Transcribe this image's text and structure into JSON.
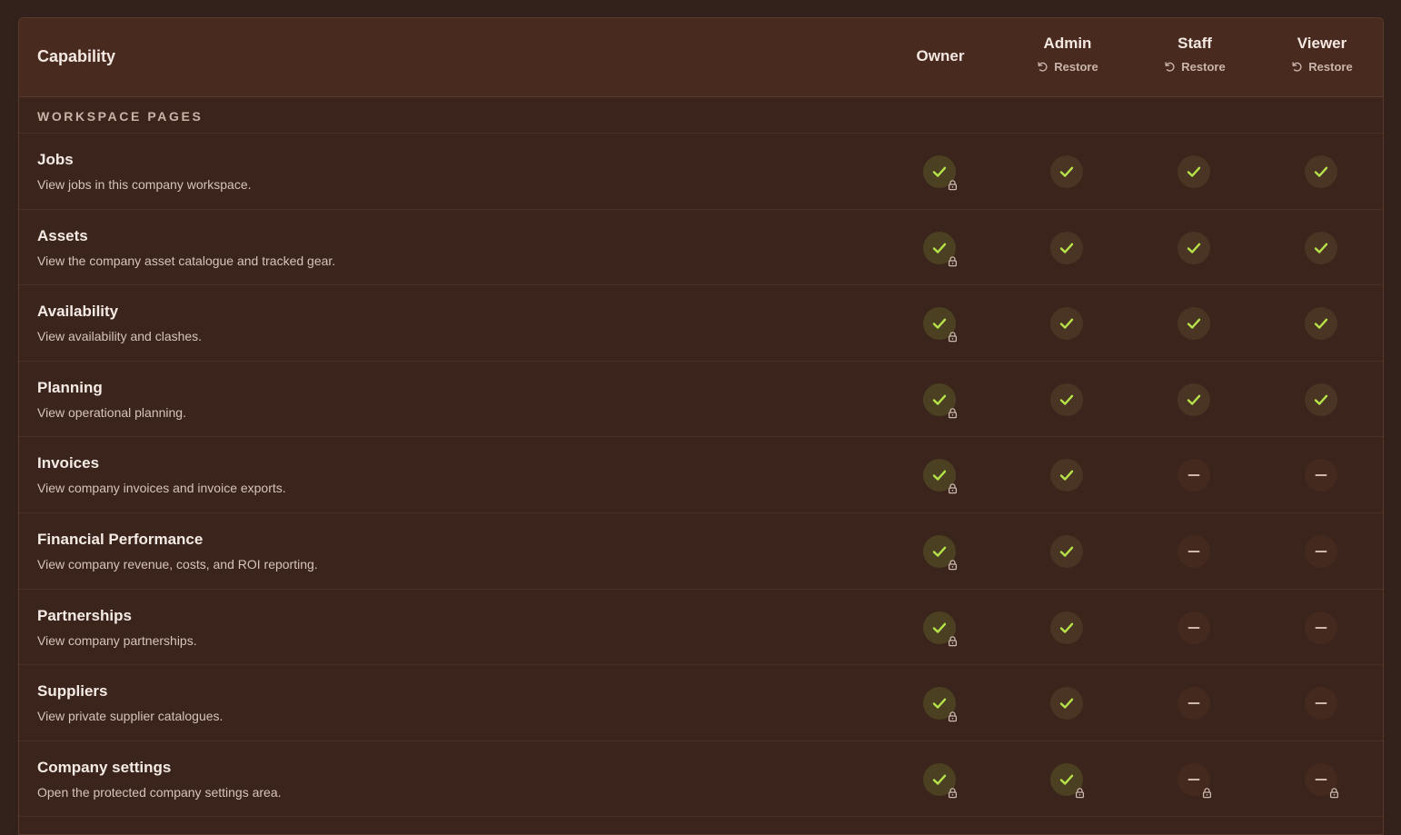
{
  "header": {
    "capability_label": "Capability",
    "roles": [
      {
        "name": "Owner",
        "restore": null
      },
      {
        "name": "Admin",
        "restore": "Restore"
      },
      {
        "name": "Staff",
        "restore": "Restore"
      },
      {
        "name": "Viewer",
        "restore": "Restore"
      }
    ]
  },
  "section": {
    "label": "WORKSPACE PAGES"
  },
  "colors": {
    "check": "#b6e34a",
    "dash": "#cdb9ae",
    "lock": "#cdb9ae"
  },
  "rows": [
    {
      "name": "Jobs",
      "desc": "View jobs in this company workspace.",
      "perms": [
        {
          "state": "on",
          "locked": true
        },
        {
          "state": "on",
          "locked": false
        },
        {
          "state": "on",
          "locked": false
        },
        {
          "state": "on",
          "locked": false
        }
      ]
    },
    {
      "name": "Assets",
      "desc": "View the company asset catalogue and tracked gear.",
      "perms": [
        {
          "state": "on",
          "locked": true
        },
        {
          "state": "on",
          "locked": false
        },
        {
          "state": "on",
          "locked": false
        },
        {
          "state": "on",
          "locked": false
        }
      ]
    },
    {
      "name": "Availability",
      "desc": "View availability and clashes.",
      "perms": [
        {
          "state": "on",
          "locked": true
        },
        {
          "state": "on",
          "locked": false
        },
        {
          "state": "on",
          "locked": false
        },
        {
          "state": "on",
          "locked": false
        }
      ]
    },
    {
      "name": "Planning",
      "desc": "View operational planning.",
      "perms": [
        {
          "state": "on",
          "locked": true
        },
        {
          "state": "on",
          "locked": false
        },
        {
          "state": "on",
          "locked": false
        },
        {
          "state": "on",
          "locked": false
        }
      ]
    },
    {
      "name": "Invoices",
      "desc": "View company invoices and invoice exports.",
      "perms": [
        {
          "state": "on",
          "locked": true
        },
        {
          "state": "on",
          "locked": false
        },
        {
          "state": "off",
          "locked": false
        },
        {
          "state": "off",
          "locked": false
        }
      ]
    },
    {
      "name": "Financial Performance",
      "desc": "View company revenue, costs, and ROI reporting.",
      "perms": [
        {
          "state": "on",
          "locked": true
        },
        {
          "state": "on",
          "locked": false
        },
        {
          "state": "off",
          "locked": false
        },
        {
          "state": "off",
          "locked": false
        }
      ]
    },
    {
      "name": "Partnerships",
      "desc": "View company partnerships.",
      "perms": [
        {
          "state": "on",
          "locked": true
        },
        {
          "state": "on",
          "locked": false
        },
        {
          "state": "off",
          "locked": false
        },
        {
          "state": "off",
          "locked": false
        }
      ]
    },
    {
      "name": "Suppliers",
      "desc": "View private supplier catalogues.",
      "perms": [
        {
          "state": "on",
          "locked": true
        },
        {
          "state": "on",
          "locked": false
        },
        {
          "state": "off",
          "locked": false
        },
        {
          "state": "off",
          "locked": false
        }
      ]
    },
    {
      "name": "Company settings",
      "desc": "Open the protected company settings area.",
      "perms": [
        {
          "state": "on",
          "locked": true
        },
        {
          "state": "on",
          "locked": true
        },
        {
          "state": "off",
          "locked": true
        },
        {
          "state": "off",
          "locked": true
        }
      ]
    }
  ]
}
